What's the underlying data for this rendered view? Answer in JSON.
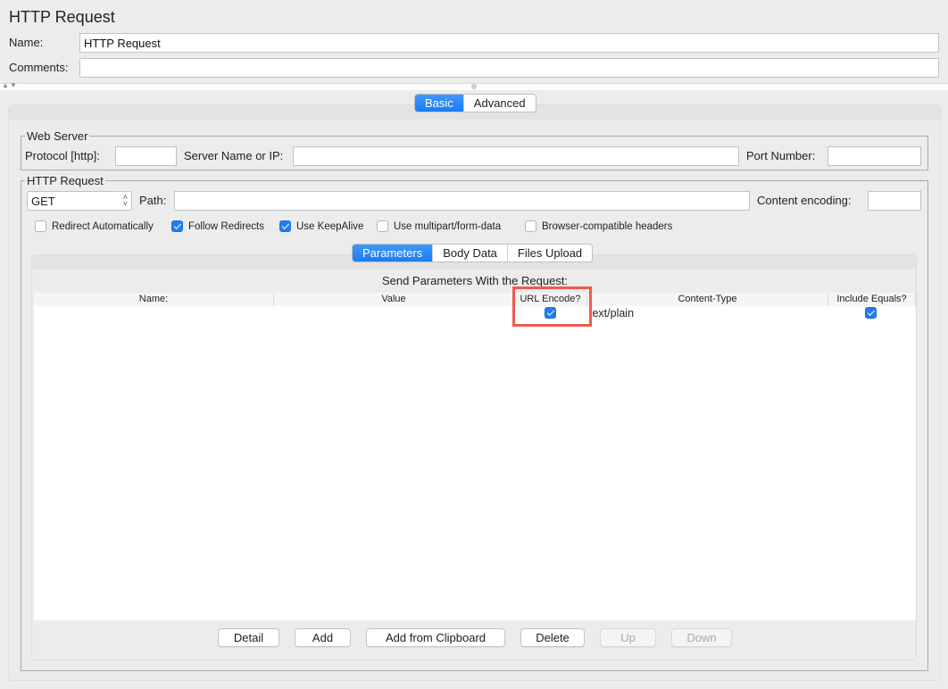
{
  "header": {
    "title": "HTTP Request",
    "name_label": "Name:",
    "name_value": "HTTP Request",
    "comments_label": "Comments:",
    "comments_value": ""
  },
  "splitter": {
    "arrows": "▲▼"
  },
  "main_tabs": [
    {
      "label": "Basic",
      "active": true
    },
    {
      "label": "Advanced",
      "active": false
    }
  ],
  "web_server": {
    "legend": "Web Server",
    "protocol_label": "Protocol [http]:",
    "protocol_value": "",
    "server_label": "Server Name or IP:",
    "server_value": "",
    "port_label": "Port Number:",
    "port_value": ""
  },
  "http_request": {
    "legend": "HTTP Request",
    "method": "GET",
    "path_label": "Path:",
    "path_value": "",
    "encoding_label": "Content encoding:",
    "encoding_value": "",
    "options": [
      {
        "label": "Redirect Automatically",
        "checked": false
      },
      {
        "label": "Follow Redirects",
        "checked": true
      },
      {
        "label": "Use KeepAlive",
        "checked": true
      },
      {
        "label": "Use multipart/form-data",
        "checked": false
      },
      {
        "label": "Browser-compatible headers",
        "checked": false
      }
    ]
  },
  "sub_tabs": [
    {
      "label": "Parameters",
      "active": true
    },
    {
      "label": "Body Data",
      "active": false
    },
    {
      "label": "Files Upload",
      "active": false
    }
  ],
  "params_table": {
    "title": "Send Parameters With the Request:",
    "columns": [
      "Name:",
      "Value",
      "URL Encode?",
      "Content-Type",
      "Include Equals?"
    ],
    "rows": [
      {
        "name": "",
        "value": "",
        "url_encode": true,
        "content_type": "text/plain",
        "include_equals": true
      }
    ]
  },
  "buttons": {
    "detail": "Detail",
    "add": "Add",
    "add_clipboard": "Add from Clipboard",
    "delete": "Delete",
    "up": "Up",
    "down": "Down"
  },
  "annotation": {
    "highlight_color": "#ef5a4e",
    "target": "URL Encode?"
  },
  "colors": {
    "accent": "#1f7ef6",
    "background": "#ececec"
  }
}
